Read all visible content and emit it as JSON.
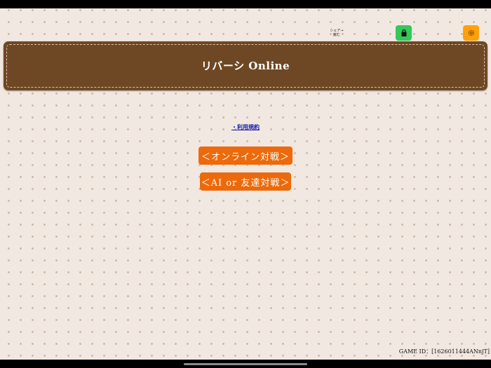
{
  "share": {
    "line1": "シェア→",
    "line2": "献む"
  },
  "toolbar": {
    "icons": [
      "bag-icon",
      "gear-icon"
    ],
    "colors": {
      "green": "#34c759",
      "orange": "#ff9f0a"
    }
  },
  "header": {
    "title": "リバーシ Online",
    "background": "#6e4824"
  },
  "links": {
    "terms": "・利用規約"
  },
  "menu": {
    "online_battle": "＜オンライン対戦＞",
    "ai_friend_battle": "＜AI or 友達対戦＞",
    "button_color": "#ec6a0b"
  },
  "footer": {
    "game_id": "GAME ID：[1626011444ANnjT]"
  }
}
